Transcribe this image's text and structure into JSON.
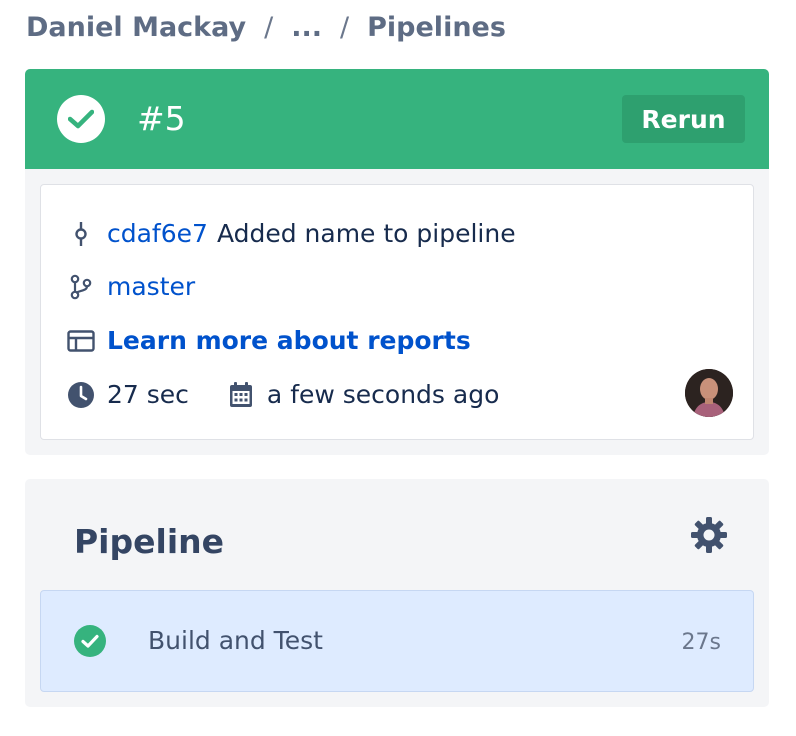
{
  "breadcrumb": {
    "items": [
      "Daniel Mackay",
      "...",
      "Pipelines"
    ],
    "separator": "/"
  },
  "run": {
    "number": "#5",
    "status": "success",
    "rerun_label": "Rerun",
    "commit_hash": "cdaf6e7",
    "commit_message": "Added name to pipeline",
    "branch": "master",
    "reports_link": "Learn more about reports",
    "duration": "27 sec",
    "time_ago": "a few seconds ago"
  },
  "pipeline": {
    "title": "Pipeline",
    "steps": [
      {
        "name": "Build and Test",
        "duration": "27s",
        "status": "success"
      }
    ]
  },
  "colors": {
    "success": "#36b37e",
    "link": "#0052cc",
    "step_bg": "#deebff",
    "card_bg": "#f4f5f7"
  },
  "icons": [
    "check-icon",
    "commit-icon",
    "branch-icon",
    "report-icon",
    "clock-icon",
    "calendar-icon",
    "gear-icon"
  ]
}
